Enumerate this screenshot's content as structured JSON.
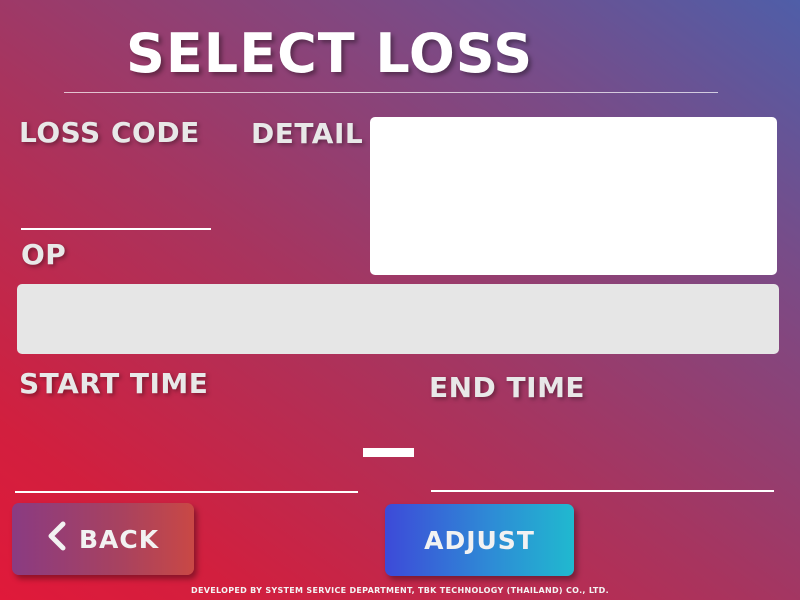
{
  "page": {
    "title": "SELECT LOSS"
  },
  "form": {
    "loss_code_label": "LOSS CODE",
    "detail_label": "DETAIL",
    "op_label": "OP",
    "start_time_label": "START TIME",
    "end_time_label": "END TIME",
    "loss_code_value": "",
    "detail_value": "",
    "op_value": "",
    "start_time_value": "",
    "end_time_value": "",
    "range_separator": "—"
  },
  "buttons": {
    "back_label": "BACK",
    "adjust_label": "ADJUST"
  },
  "footer": {
    "text": "DEVELOPED BY SYSTEM SERVICE DEPARTMENT, TBK TECHNOLOGY (THAILAND) CO., LTD."
  },
  "icons": {
    "back": "chevron-left-icon"
  },
  "colors": {
    "background_top_right": "#4f5ea8",
    "background_bottom_left": "#e0193a",
    "back_button": "#a8425f",
    "adjust_button_start": "#3d4ad8",
    "adjust_button_end": "#20b9cf",
    "detail_box": "#ffffff",
    "op_box": "#e6e6e6"
  }
}
